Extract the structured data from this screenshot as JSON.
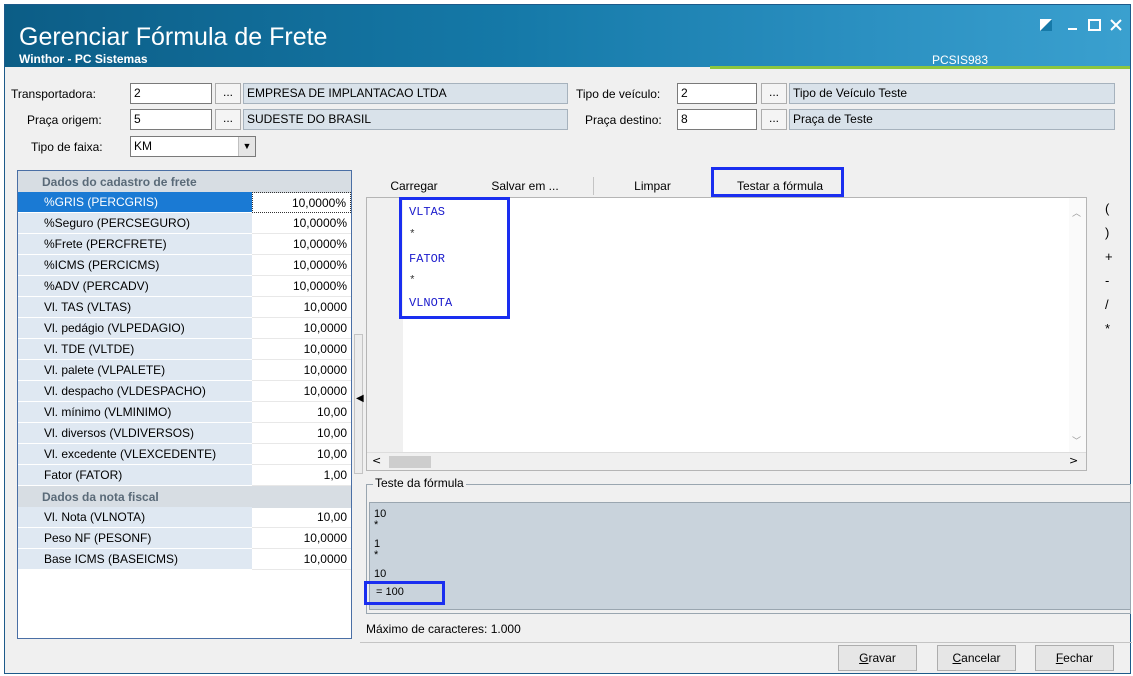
{
  "window": {
    "title": "Gerenciar Fórmula de Frete",
    "subtitle": "Winthor - PC Sistemas",
    "code": "PCSIS983"
  },
  "form": {
    "transportadora_label": "Transportadora:",
    "transportadora_value": "2",
    "transportadora_desc": "EMPRESA DE IMPLANTACAO LTDA",
    "tipo_veiculo_label": "Tipo de veículo:",
    "tipo_veiculo_value": "2",
    "tipo_veiculo_desc": "Tipo de Veículo Teste",
    "praca_origem_label": "Praça origem:",
    "praca_origem_value": "5",
    "praca_origem_desc": "SUDESTE DO BRASIL",
    "praca_destino_label": "Praça destino:",
    "praca_destino_value": "8",
    "praca_destino_desc": "Praça de Teste",
    "tipo_faixa_label": "Tipo de faixa:",
    "tipo_faixa_value": "KM",
    "lookup_label": "..."
  },
  "grid": {
    "section1": "Dados do cadastro de frete",
    "rows1": [
      {
        "name": "%GRIS (PERCGRIS)",
        "value": "10,0000%"
      },
      {
        "name": "%Seguro (PERCSEGURO)",
        "value": "10,0000%"
      },
      {
        "name": "%Frete (PERCFRETE)",
        "value": "10,0000%"
      },
      {
        "name": "%ICMS (PERCICMS)",
        "value": "10,0000%"
      },
      {
        "name": "%ADV (PERCADV)",
        "value": "10,0000%"
      },
      {
        "name": "Vl. TAS (VLTAS)",
        "value": "10,0000"
      },
      {
        "name": "Vl. pedágio (VLPEDAGIO)",
        "value": "10,0000"
      },
      {
        "name": "Vl. TDE (VLTDE)",
        "value": "10,0000"
      },
      {
        "name": "Vl. palete (VLPALETE)",
        "value": "10,0000"
      },
      {
        "name": "Vl. despacho (VLDESPACHO)",
        "value": "10,0000"
      },
      {
        "name": "Vl. mínimo (VLMINIMO)",
        "value": "10,00"
      },
      {
        "name": "Vl. diversos (VLDIVERSOS)",
        "value": "10,00"
      },
      {
        "name": "Vl. excedente (VLEXCEDENTE)",
        "value": "10,00"
      },
      {
        "name": "Fator (FATOR)",
        "value": "1,00"
      }
    ],
    "section2": "Dados da nota fiscal",
    "rows2": [
      {
        "name": "Vl. Nota (VLNOTA)",
        "value": "10,00"
      },
      {
        "name": "Peso NF (PESONF)",
        "value": "10,0000"
      },
      {
        "name": "Base ICMS (BASEICMS)",
        "value": "10,0000"
      }
    ]
  },
  "toolbar": {
    "carregar": "Carregar",
    "salvar": "Salvar em ...",
    "limpar": "Limpar",
    "testar": "Testar a fórmula"
  },
  "editor": {
    "lines": [
      "VLTAS",
      "*",
      "FATOR",
      "*",
      "VLNOTA"
    ]
  },
  "operators": [
    "(",
    ")",
    "+",
    "-",
    "/",
    "*"
  ],
  "teste": {
    "legend": "Teste da fórmula",
    "lines": [
      "10",
      "*",
      "1",
      "*",
      "10",
      "= 100"
    ]
  },
  "status": {
    "max_chars": "Máximo de caracteres: 1.000"
  },
  "footer": {
    "gravar_u": "G",
    "gravar_rest": "ravar",
    "cancelar_u": "C",
    "cancelar_rest": "ancelar",
    "fechar_u": "F",
    "fechar_rest": "echar"
  }
}
